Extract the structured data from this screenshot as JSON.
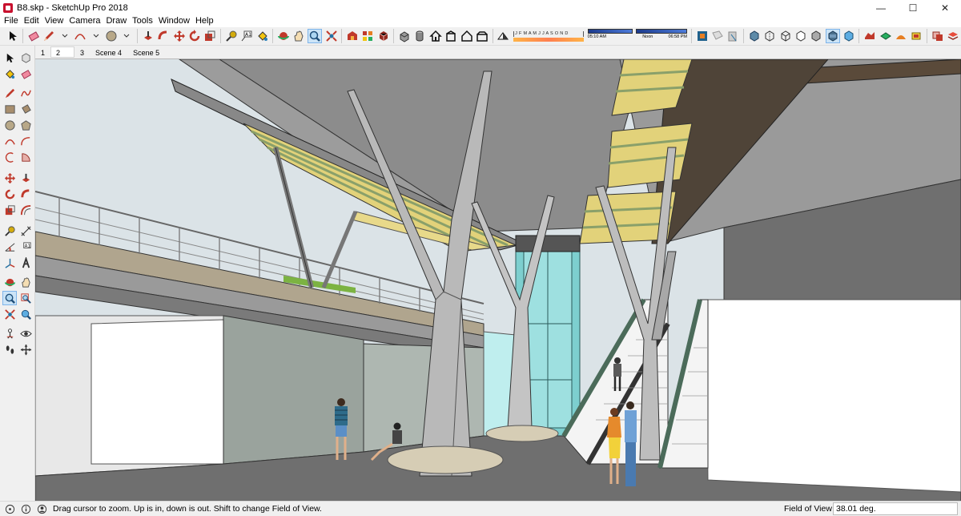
{
  "window": {
    "title": "B8.skp - SketchUp Pro 2018",
    "minimize": "—",
    "maximize": "☐",
    "close": "✕"
  },
  "menu": [
    "File",
    "Edit",
    "View",
    "Camera",
    "Draw",
    "Tools",
    "Window",
    "Help"
  ],
  "shadow": {
    "months": "J F M A M J J A S O N D",
    "time_start": "05:10 AM",
    "time_noon": "Noon",
    "time_end": "06:58 PM"
  },
  "scenes": [
    "1",
    "2",
    "3",
    "Scene 4",
    "Scene 5"
  ],
  "active_scene": "2",
  "status": {
    "hint": "Drag cursor to zoom.  Up is in, down is out. Shift to change Field of View.",
    "measure_label": "Field of View",
    "measure_value": "38.01 deg."
  },
  "colors": {
    "accent": "#7eb4ea",
    "roof_yellow": "#e2d27a",
    "glass": "#8fd6d6",
    "stone": "#d6cdb5"
  }
}
